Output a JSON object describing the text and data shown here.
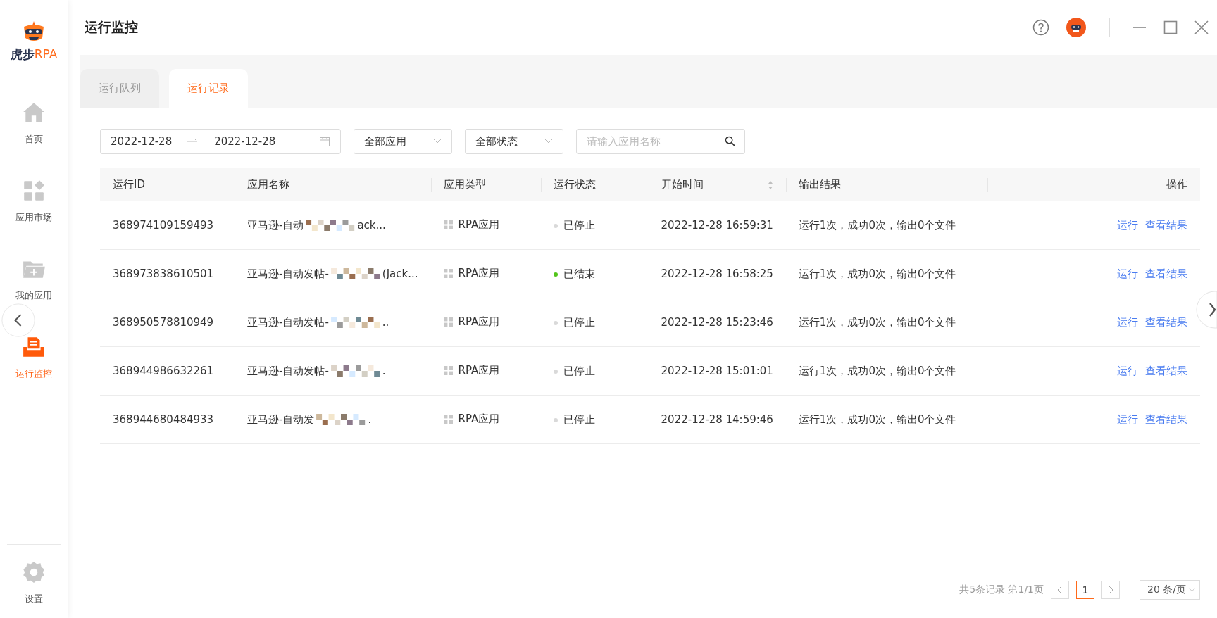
{
  "sidebar": {
    "logo_text": "虎步",
    "logo_accent": "RPA",
    "items": [
      {
        "label": "首页",
        "kind": "home",
        "selected": false
      },
      {
        "label": "应用市场",
        "kind": "apps",
        "selected": false
      },
      {
        "label": "我的应用",
        "kind": "folder",
        "selected": false
      },
      {
        "label": "运行监控",
        "kind": "monitor",
        "selected": true
      }
    ],
    "settings": {
      "label": "设置"
    }
  },
  "header": {
    "title": "运行监控"
  },
  "tabs": [
    {
      "label": "运行队列",
      "selected": false
    },
    {
      "label": "运行记录",
      "selected": true
    }
  ],
  "filters": {
    "date_start": "2022-12-28",
    "date_end": "2022-12-28",
    "app_select": "全部应用",
    "status_select": "全部状态",
    "search": {
      "placeholder": "请输入应用名称"
    }
  },
  "table": {
    "columns": [
      {
        "label": "运行ID"
      },
      {
        "label": "应用名称"
      },
      {
        "label": "应用类型"
      },
      {
        "label": "运行状态"
      },
      {
        "label": "开始时间",
        "sortable": true
      },
      {
        "label": "输出结果"
      },
      {
        "label": "操作"
      }
    ],
    "rows": [
      {
        "id": "368974109159493",
        "name": "亚马逊-自动",
        "name_tail": "ack...",
        "type": "RPA应用",
        "status": "已停止",
        "color": "#d9d9d9",
        "start": "2022-12-28 16:59:31",
        "output": "运行1次，成功0次，输出0个文件",
        "actions": [
          "运行",
          "查看结果"
        ]
      },
      {
        "id": "368973838610501",
        "name": "亚马逊-自动发帖-",
        "name_tail": "(Jack...",
        "type": "RPA应用",
        "status": "已结束",
        "color": "#52c41a",
        "start": "2022-12-28 16:58:25",
        "output": "运行1次，成功0次，输出0个文件",
        "actions": [
          "运行",
          "查看结果"
        ]
      },
      {
        "id": "368950578810949",
        "name": "亚马逊-自动发帖-",
        "name_tail": "..",
        "type": "RPA应用",
        "status": "已停止",
        "color": "#d9d9d9",
        "start": "2022-12-28 15:23:46",
        "output": "运行1次，成功0次，输出0个文件",
        "actions": [
          "运行",
          "查看结果"
        ]
      },
      {
        "id": "368944986632261",
        "name": "亚马逊-自动发帖-",
        "name_tail": ".",
        "type": "RPA应用",
        "status": "已停止",
        "color": "#d9d9d9",
        "start": "2022-12-28 15:01:01",
        "output": "运行1次，成功0次，输出0个文件",
        "actions": [
          "运行",
          "查看结果"
        ]
      },
      {
        "id": "368944680484933",
        "name": "亚马逊-自动发",
        "name_tail": ".",
        "type": "RPA应用",
        "status": "已停止",
        "color": "#d9d9d9",
        "start": "2022-12-28 14:59:46",
        "output": "运行1次，成功0次，输出0个文件",
        "actions": [
          "运行",
          "查看结果"
        ]
      }
    ]
  },
  "pagination": {
    "summary": "共5条记录 第1/1页",
    "pages": [
      {
        "label": "1",
        "selected": true
      }
    ],
    "page_size": "20 条/页"
  }
}
